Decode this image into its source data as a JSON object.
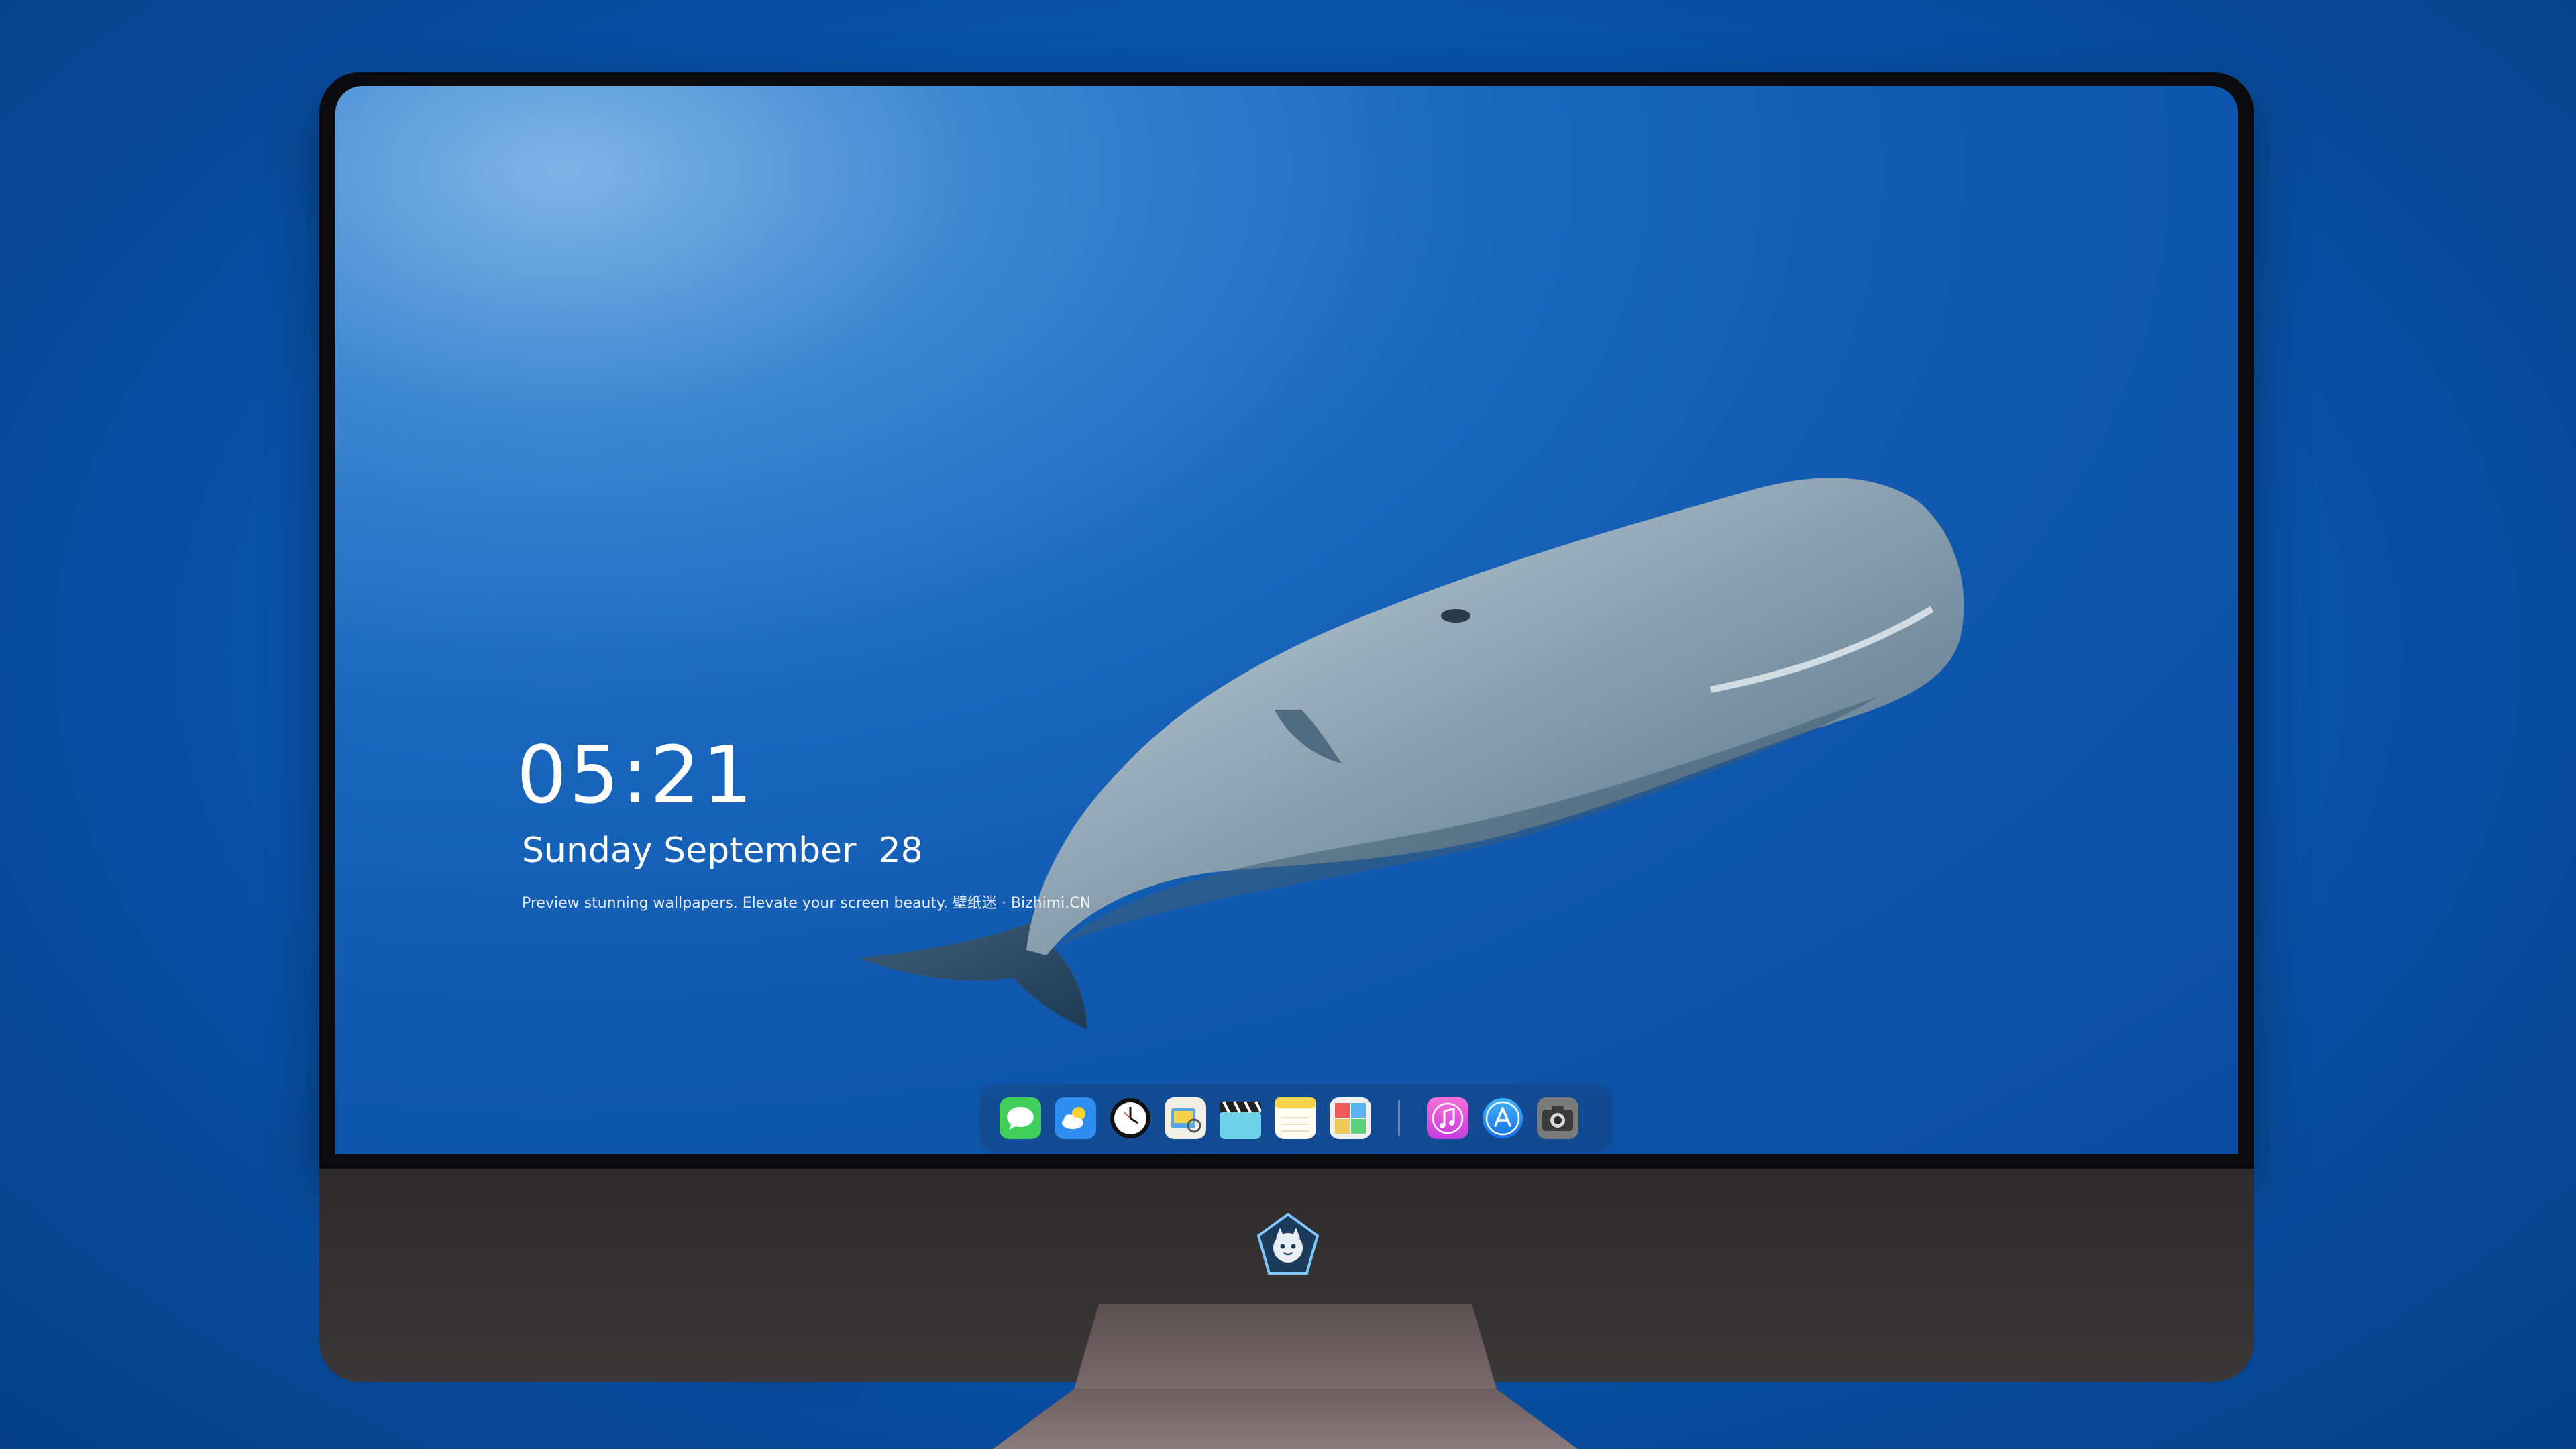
{
  "lockscreen": {
    "time": "05:21",
    "date": "Sunday September  28",
    "tagline": "Preview stunning wallpapers. Elevate your screen beauty. 壁纸迷 · Bizhimi.CN"
  },
  "dock": {
    "apps": [
      {
        "name": "messages-icon"
      },
      {
        "name": "weather-icon"
      },
      {
        "name": "clock-icon"
      },
      {
        "name": "preview-icon"
      },
      {
        "name": "clapperboard-icon"
      },
      {
        "name": "notes-icon"
      },
      {
        "name": "photo-booth-icon"
      }
    ],
    "pinned": [
      {
        "name": "music-icon"
      },
      {
        "name": "app-store-icon"
      },
      {
        "name": "camera-icon"
      }
    ]
  },
  "colors": {
    "background": "#0a52a8",
    "bezel": "#0b0b0d",
    "chin": "#343132",
    "stand": "#6e6062"
  }
}
